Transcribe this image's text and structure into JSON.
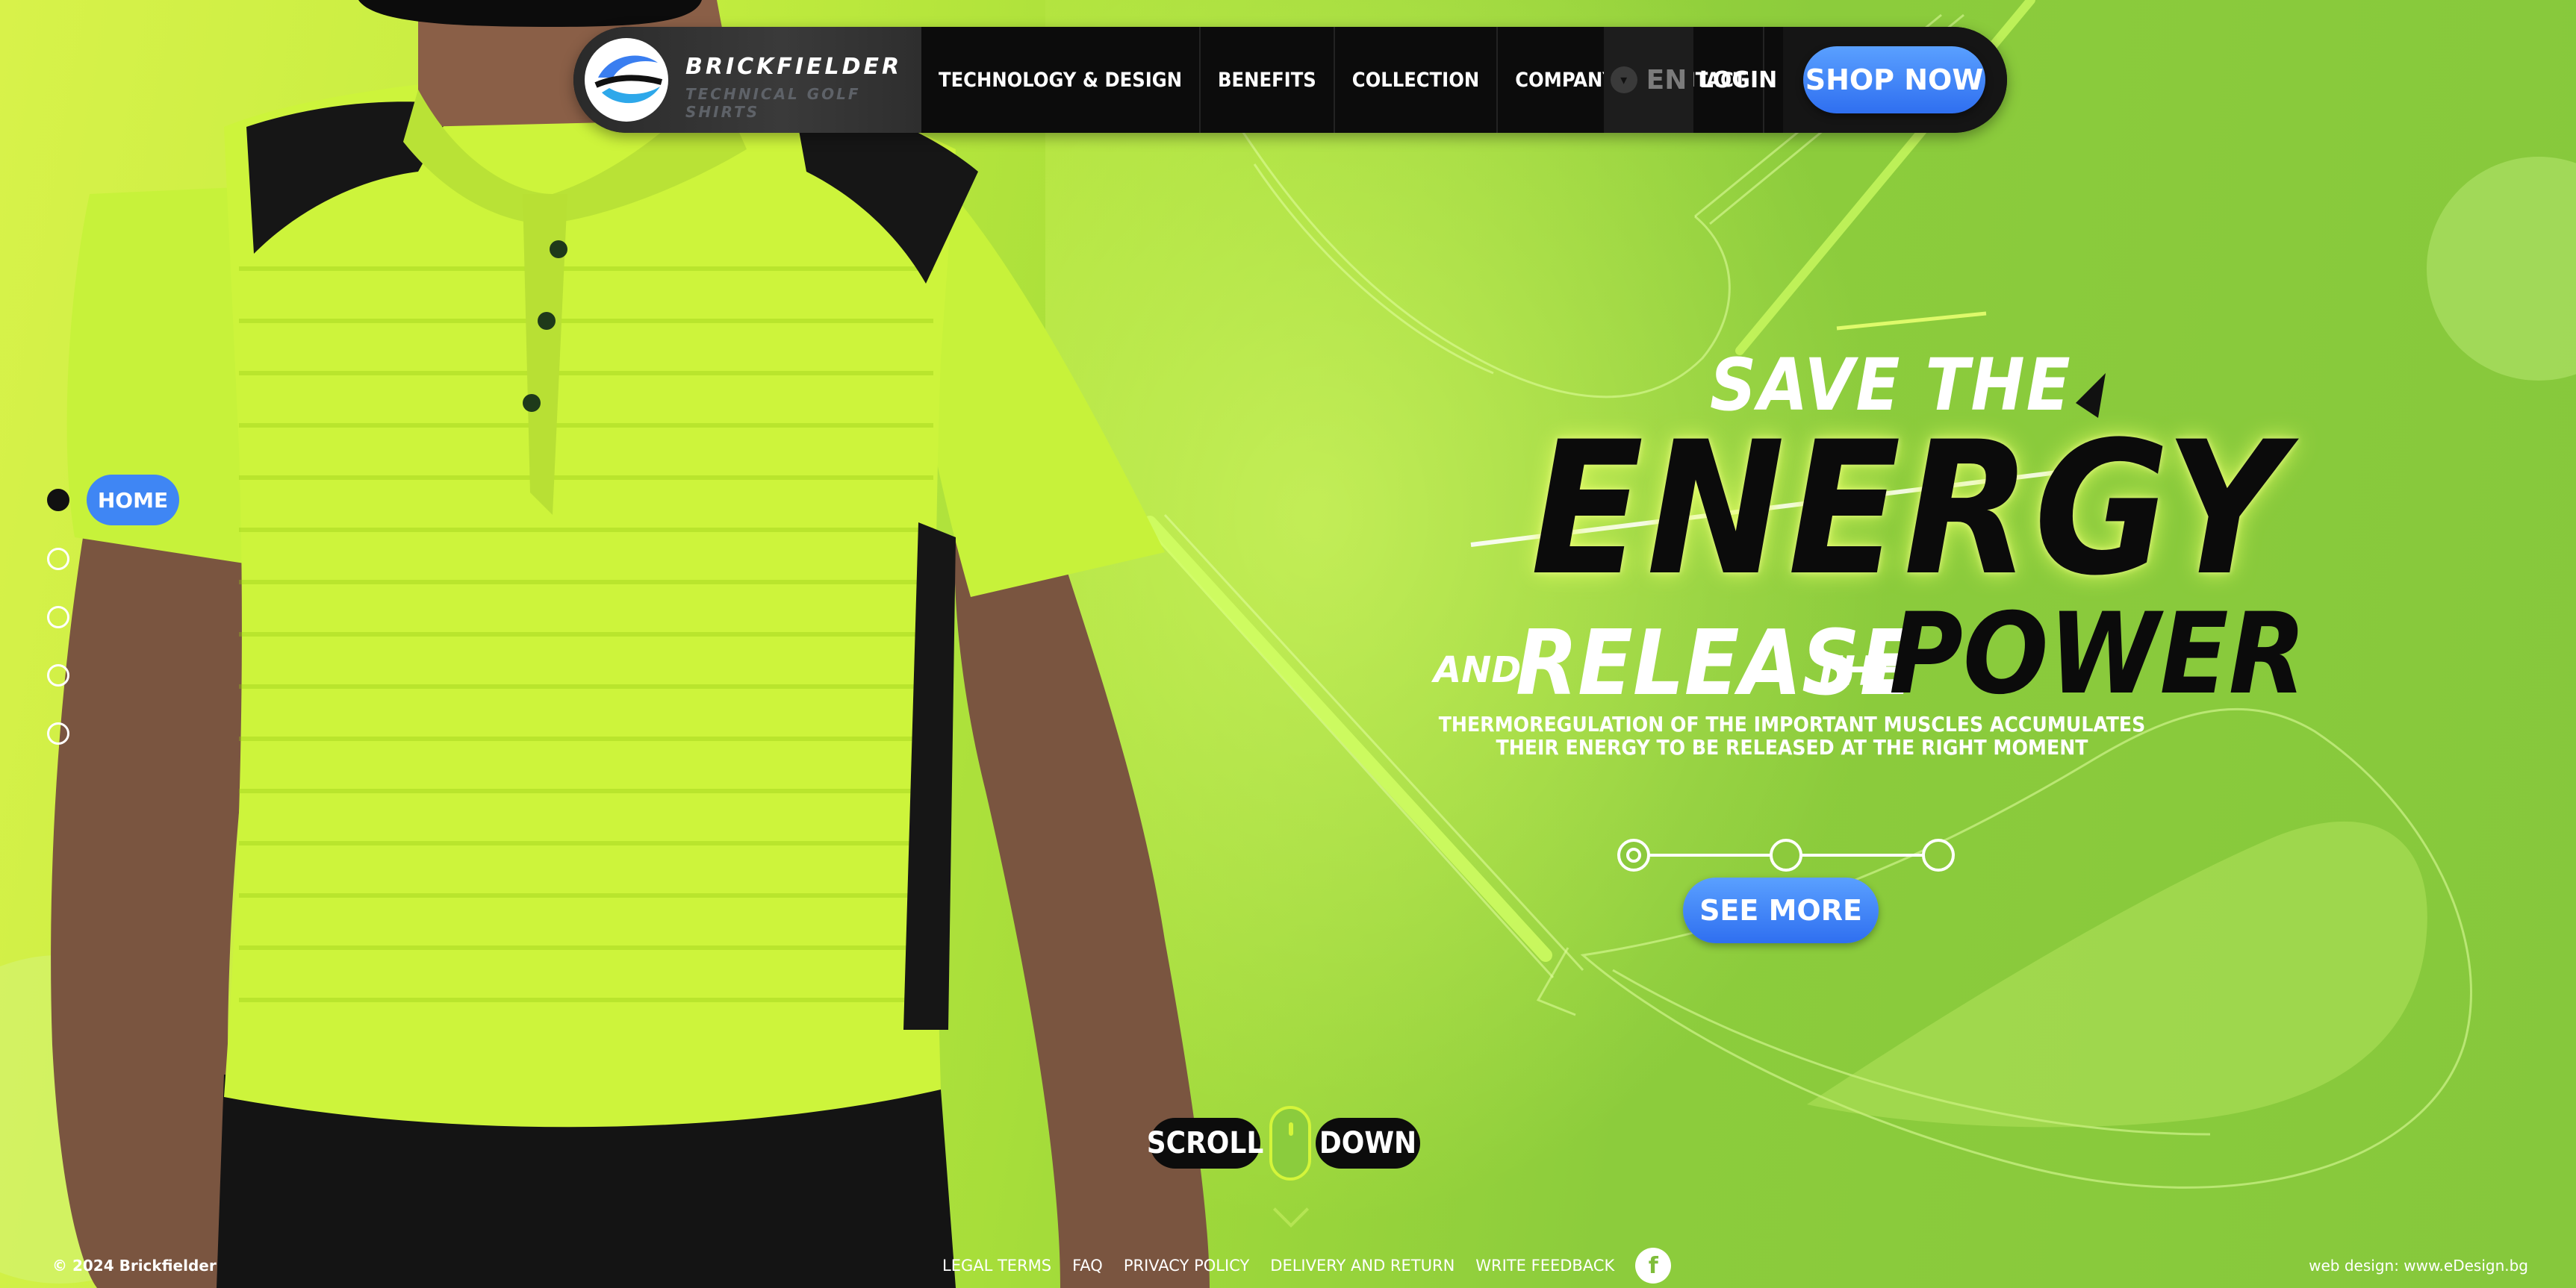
{
  "brand": {
    "name": "BRICKFIELDER",
    "tagline": "TECHNICAL GOLF SHIRTS"
  },
  "nav": {
    "items": [
      {
        "label": "TECHNOLOGY & DESIGN"
      },
      {
        "label": "BENEFITS"
      },
      {
        "label": "COLLECTION"
      },
      {
        "label": "COMPANY"
      },
      {
        "label": "CONTACT"
      }
    ],
    "language": "EN",
    "login": "LOGIN",
    "shop_now": "SHOP NOW"
  },
  "side_nav": {
    "active_label": "HOME",
    "dot_count": 5,
    "active_index": 0
  },
  "hero": {
    "line1": "SAVE THE",
    "line2": "ENERGY",
    "and": "AND",
    "release": "RELEASE",
    "the": "THE",
    "power": "POWER",
    "subtitle_line1": "THERMOREGULATION OF THE IMPORTANT MUSCLES ACCUMULATES",
    "subtitle_line2": "THEIR ENERGY TO BE RELEASED AT THE RIGHT MOMENT",
    "slides": 3,
    "active_slide": 0,
    "cta": "SEE MORE"
  },
  "scroll": {
    "left": "SCROLL",
    "right": "DOWN"
  },
  "footer": {
    "copyright": "© 2024 Brickfielder",
    "links": [
      {
        "label": "LEGAL TERMS"
      },
      {
        "label": "FAQ"
      },
      {
        "label": "PRIVACY POLICY"
      },
      {
        "label": "DELIVERY AND RETURN"
      },
      {
        "label": "WRITE FEEDBACK"
      }
    ],
    "social_icon": "facebook-icon",
    "credit": "web design: www.eDesign.bg"
  },
  "colors": {
    "accent_blue": "#3f86f4",
    "lime": "#c8f040",
    "header_bg": "#0c0c0c"
  }
}
